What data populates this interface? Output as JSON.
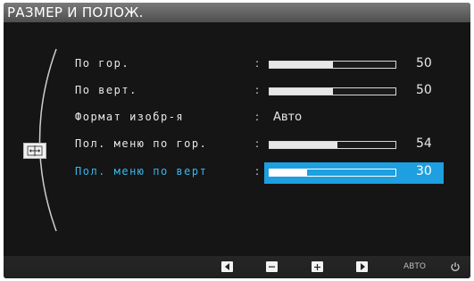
{
  "title": "РАЗМЕР И ПОЛОЖ.",
  "menu": {
    "category_icon": "size-position-icon",
    "items": [
      {
        "label": "По гор.",
        "value": "50",
        "level_percent": 50,
        "type": "slider",
        "selected": false
      },
      {
        "label": "По верт.",
        "value": "50",
        "level_percent": 50,
        "type": "slider",
        "selected": false
      },
      {
        "label": "Формат изобр-я",
        "value": "Авто",
        "type": "text",
        "selected": false
      },
      {
        "label": "Пол. меню по гор.",
        "value": "54",
        "level_percent": 54,
        "type": "slider",
        "selected": false
      },
      {
        "label": "Пол. меню по верт",
        "value": "30",
        "level_percent": 30,
        "type": "slider",
        "selected": true
      }
    ],
    "separator": ":"
  },
  "bottom_bar": {
    "buttons": [
      {
        "icon": "left-arrow-icon"
      },
      {
        "icon": "minus-icon"
      },
      {
        "icon": "plus-icon"
      },
      {
        "icon": "right-arrow-icon"
      },
      {
        "label": "АВТО"
      },
      {
        "icon": "power-icon"
      }
    ]
  },
  "colors": {
    "accent": "#1d9fe0",
    "selected_label": "#39b6ea",
    "background": "#151515"
  }
}
